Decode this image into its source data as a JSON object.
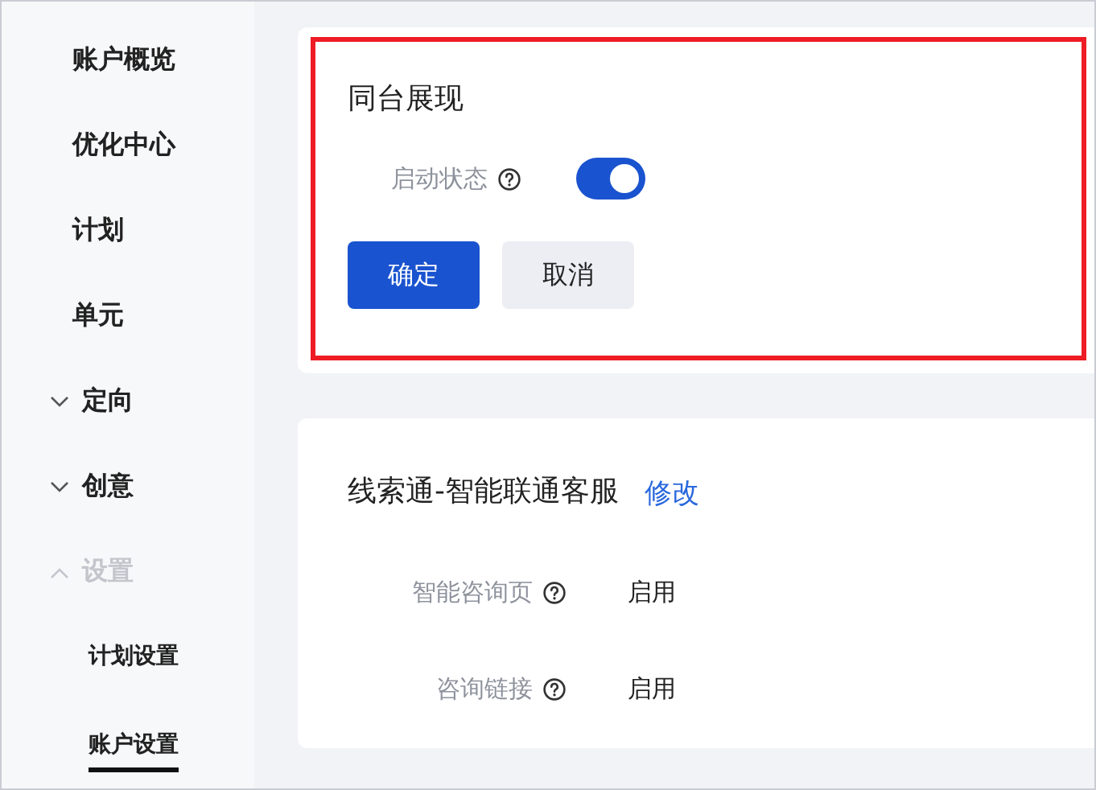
{
  "sidebar": {
    "items": [
      {
        "label": "账户概览",
        "kind": "link",
        "disabled": false
      },
      {
        "label": "优化中心",
        "kind": "link",
        "disabled": false
      },
      {
        "label": "计划",
        "kind": "link",
        "disabled": false
      },
      {
        "label": "单元",
        "kind": "link",
        "disabled": false
      },
      {
        "label": "定向",
        "kind": "group",
        "expanded": false,
        "disabled": false
      },
      {
        "label": "创意",
        "kind": "group",
        "expanded": false,
        "disabled": false
      },
      {
        "label": "设置",
        "kind": "group",
        "expanded": true,
        "disabled": true,
        "children": [
          {
            "label": "计划设置",
            "selected": false
          },
          {
            "label": "账户设置",
            "selected": true
          }
        ]
      }
    ]
  },
  "display_card": {
    "title": "同台展现",
    "highlighted": true,
    "field": {
      "label": "启动状态",
      "on": true
    },
    "buttons": [
      {
        "label": "确定",
        "kind": "primary"
      },
      {
        "label": "取消",
        "kind": "secondary"
      }
    ]
  },
  "lead_card": {
    "title": "线索通-智能联通客服",
    "link": "修改",
    "rows": [
      {
        "label": "智能咨询页",
        "value": "启用"
      },
      {
        "label": "咨询链接",
        "value": "启用"
      }
    ]
  }
}
